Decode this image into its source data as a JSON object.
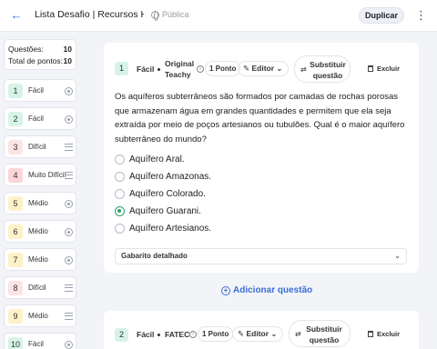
{
  "header": {
    "title": "Lista Desafio | Recursos Hí...",
    "visibility": "Pública",
    "duplicate_label": "Duplicar"
  },
  "summary": {
    "questions_label": "Questões:",
    "questions_value": "10",
    "points_label": "Total de pontos:",
    "points_value": "10"
  },
  "sidebar": {
    "items": [
      {
        "num": "1",
        "label": "Fácil",
        "type": "multiple-choice",
        "color": "#d7f3e8"
      },
      {
        "num": "2",
        "label": "Fácil",
        "type": "multiple-choice",
        "color": "#d7f3e8"
      },
      {
        "num": "3",
        "label": "Difícil",
        "type": "open-text",
        "color": "#fde4e4"
      },
      {
        "num": "4",
        "label": "Muito Difícil",
        "type": "open-text",
        "color": "#fbd5d8"
      },
      {
        "num": "5",
        "label": "Médio",
        "type": "multiple-choice",
        "color": "#fdf1c8"
      },
      {
        "num": "6",
        "label": "Médio",
        "type": "multiple-choice",
        "color": "#fdf1c8"
      },
      {
        "num": "7",
        "label": "Médio",
        "type": "multiple-choice",
        "color": "#fdf1c8"
      },
      {
        "num": "8",
        "label": "Difícil",
        "type": "open-text",
        "color": "#fde4e4"
      },
      {
        "num": "9",
        "label": "Médio",
        "type": "open-text",
        "color": "#fdf1c8"
      },
      {
        "num": "10",
        "label": "Fácil",
        "type": "multiple-choice",
        "color": "#d7f3e8"
      }
    ]
  },
  "question1": {
    "num": "1",
    "difficulty": "Fácil",
    "source_line1": "Original",
    "source_line2": "Teachy",
    "points": "1 Ponto",
    "edit_label": "Editor",
    "substitute_line1": "Substituir",
    "substitute_line2": "questão",
    "delete_label": "Excluir",
    "text": "Os aquíferos subterrâneos são formados por camadas de rochas porosas que armazenam água em grandes quantidades e permitem que ela seja extraída por meio de poços artesianos ou tubulões. Qual é o maior aquífero subterrâneo do mundo?",
    "options": [
      {
        "label": "Aquífero Aral.",
        "selected": false
      },
      {
        "label": "Aquífero Amazonas.",
        "selected": false
      },
      {
        "label": "Aquífero Colorado.",
        "selected": false
      },
      {
        "label": "Aquífero Guarani.",
        "selected": true
      },
      {
        "label": "Aquífero Artesianos.",
        "selected": false
      }
    ],
    "answer_key_label": "Gabarito detalhado"
  },
  "add_question_label": "Adicionar questão",
  "question2": {
    "num": "2",
    "difficulty": "Fácil",
    "source": "FATEC",
    "points": "1 Ponto",
    "edit_label": "Editor",
    "substitute_line1": "Substituir",
    "substitute_line2": "questão",
    "delete_label": "Excluir"
  },
  "colors": {
    "accent": "#3a6fd8",
    "correct": "#2ca26a",
    "easy": "#d7f3e8",
    "medium": "#fdf1c8",
    "hard": "#fde4e4"
  }
}
